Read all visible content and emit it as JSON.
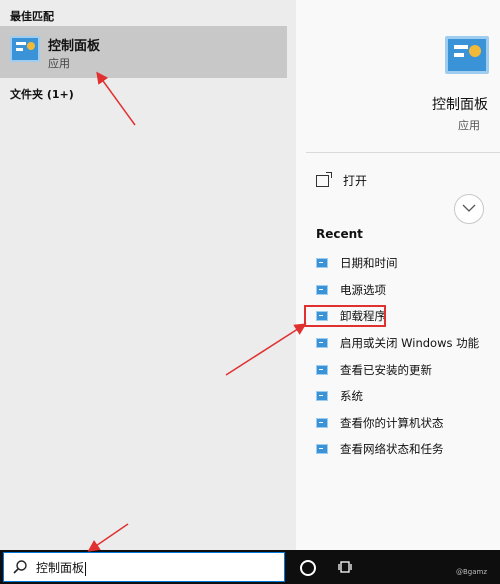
{
  "left_panel": {
    "section_title": "最佳匹配",
    "best_match": {
      "title": "控制面板",
      "subtitle": "应用"
    },
    "folder_group": "文件夹 (1+)"
  },
  "right_panel": {
    "app_name": "控制面板",
    "app_type": "应用",
    "open_label": "打开",
    "recent_title": "Recent",
    "recent_items": [
      "日期和时间",
      "电源选项",
      "卸载程序",
      "启用或关闭 Windows 功能",
      "查看已安装的更新",
      "系统",
      "查看你的计算机状态",
      "查看网络状态和任务"
    ]
  },
  "taskbar": {
    "search_value": "控制面板"
  },
  "watermark": "@Bgamz",
  "colors": {
    "highlight_box": "#e03030",
    "annotation_arrow": "#e03030",
    "icon_blue": "#3a93d6"
  }
}
